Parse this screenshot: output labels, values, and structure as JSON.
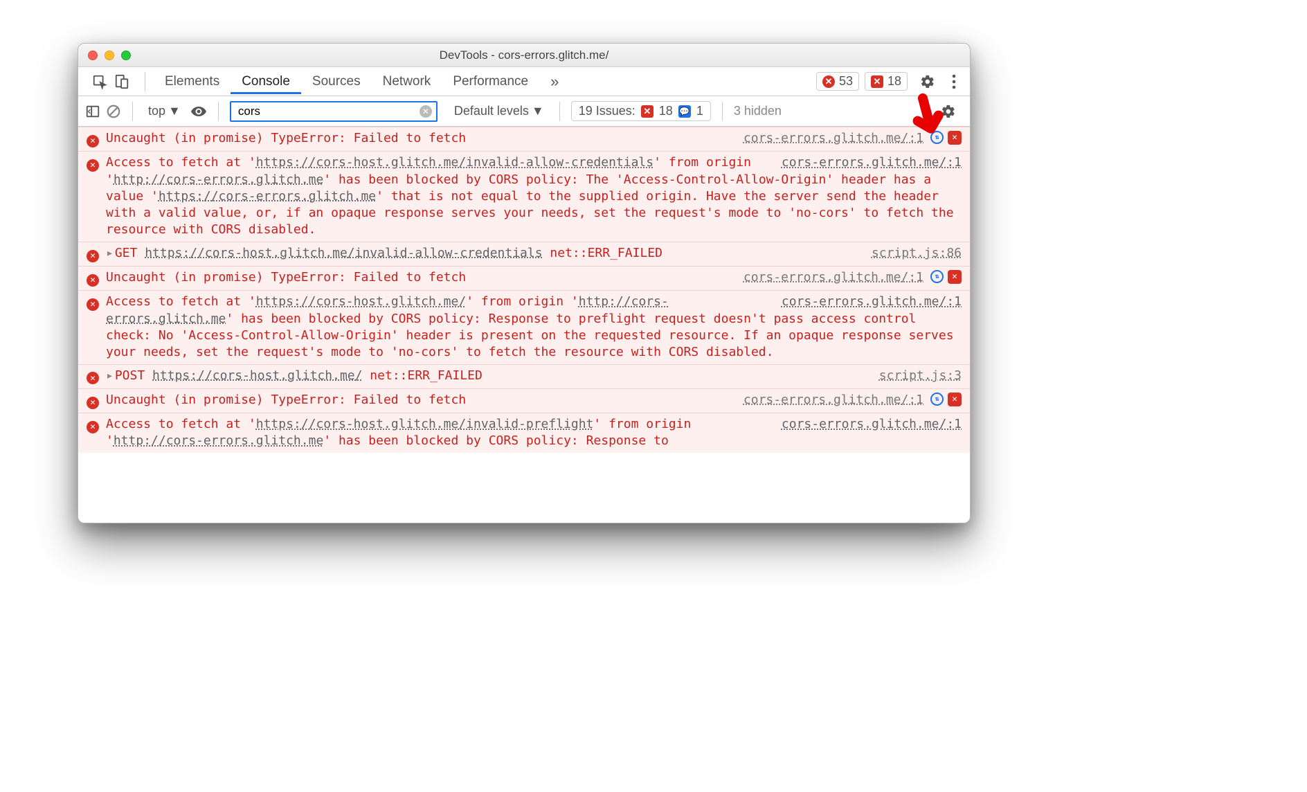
{
  "window": {
    "title": "DevTools - cors-errors.glitch.me/"
  },
  "tabs": {
    "items": [
      "Elements",
      "Console",
      "Sources",
      "Network",
      "Performance"
    ],
    "active": "Console",
    "more": "»"
  },
  "counters": {
    "errors": "53",
    "issues_badge": "18"
  },
  "filter": {
    "context": "top",
    "input_value": "cors",
    "levels": "Default levels",
    "issues_label": "19 Issues:",
    "issues_err": "18",
    "issues_msg": "1",
    "hidden": "3 hidden"
  },
  "rows": [
    {
      "type": "error",
      "text": "Uncaught (in promise) TypeError: Failed to fetch",
      "source": "cors-errors.glitch.me/:1",
      "right_icons": true
    },
    {
      "type": "error",
      "source_inline": "cors-errors.glitch.me/:1",
      "parts": [
        {
          "t": "Access to fetch at '"
        },
        {
          "u": "https://cors-host.glitch.me/invalid-allow-credentials"
        },
        {
          "t": "' from origin '"
        },
        {
          "u": "http://cors-errors.glitch.me"
        },
        {
          "t": "' has been blocked by CORS policy: The 'Access-Control-Allow-Origin' header has a value '"
        },
        {
          "u": "https://cors-errors.glitch.me"
        },
        {
          "t": "' that is not equal to the supplied origin. Have the server send the header with a valid value, or, if an opaque response serves your needs, set the request's mode to 'no-cors' to fetch the resource with CORS disabled."
        }
      ]
    },
    {
      "type": "error",
      "expand": true,
      "method": "GET",
      "url": "https://cors-host.glitch.me/invalid-allow-credentials",
      "tail": " net::ERR_FAILED",
      "source": "script.js:86"
    },
    {
      "type": "error",
      "text": "Uncaught (in promise) TypeError: Failed to fetch",
      "source": "cors-errors.glitch.me/:1",
      "right_icons": true
    },
    {
      "type": "error",
      "source_inline": "cors-errors.glitch.me/:1",
      "parts": [
        {
          "t": "Access to fetch at '"
        },
        {
          "u": "https://cors-host.glitch.me/"
        },
        {
          "t": "' from origin '"
        },
        {
          "u": "http://cors-errors.glitch.me"
        },
        {
          "t": "' has been blocked by CORS policy: Response to preflight request doesn't pass access control check: No 'Access-Control-Allow-Origin' header is present on the requested resource. If an opaque response serves your needs, set the request's mode to 'no-cors' to fetch the resource with CORS disabled."
        }
      ]
    },
    {
      "type": "error",
      "expand": true,
      "method": "POST",
      "url": "https://cors-host.glitch.me/",
      "tail": " net::ERR_FAILED",
      "source": "script.js:3"
    },
    {
      "type": "error",
      "text": "Uncaught (in promise) TypeError: Failed to fetch",
      "source": "cors-errors.glitch.me/:1",
      "right_icons": true
    },
    {
      "type": "error",
      "source_inline": "cors-errors.glitch.me/:1",
      "parts": [
        {
          "t": "Access to fetch at '"
        },
        {
          "u": "https://cors-host.glitch.me/invalid-preflight"
        },
        {
          "t": "' from origin '"
        },
        {
          "u": "http://cors-errors.glitch.me"
        },
        {
          "t": "' has been blocked by CORS policy: Response to"
        }
      ]
    }
  ]
}
